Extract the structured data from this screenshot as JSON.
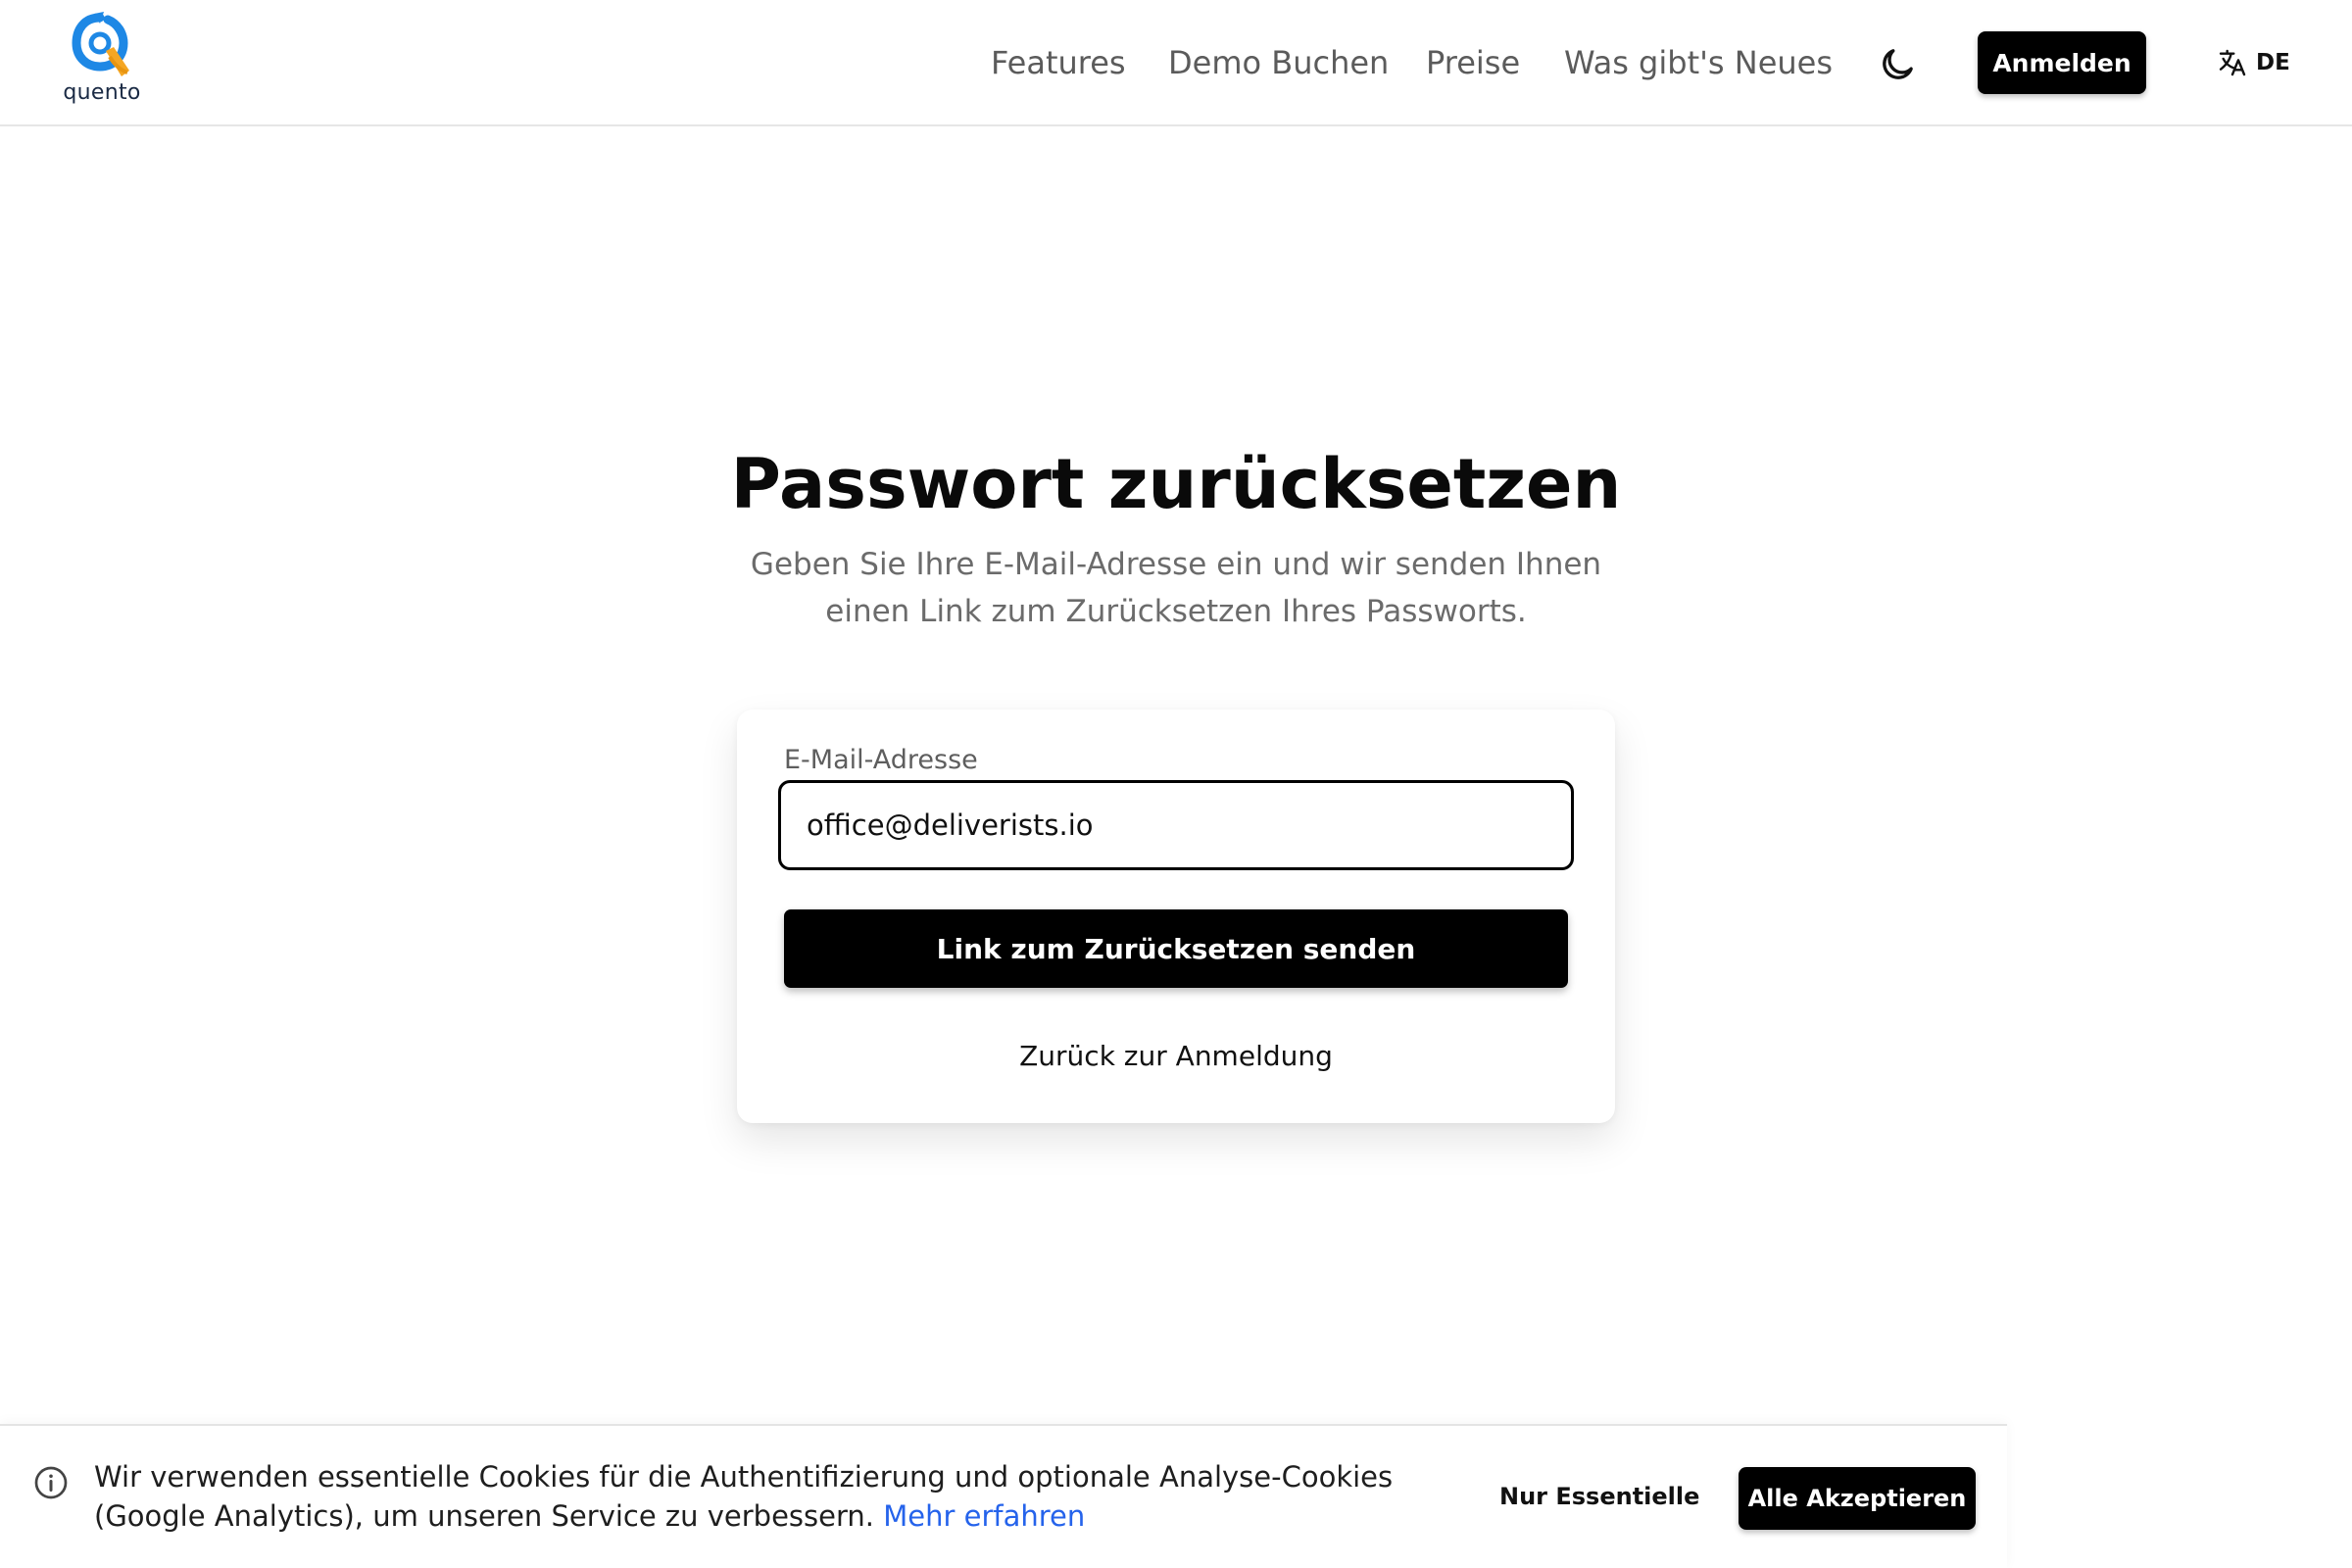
{
  "header": {
    "logo_text": "quento",
    "nav": {
      "features": "Features",
      "demo": "Demo Buchen",
      "preise": "Preise",
      "news": "Was gibt's Neues"
    },
    "theme_icon": "moon-icon",
    "login_label": "Anmelden",
    "language_icon": "translate-icon",
    "language_label": "DE"
  },
  "main": {
    "title": "Passwort zurücksetzen",
    "subtitle": "Geben Sie Ihre E-Mail-Adresse ein und wir senden Ihnen einen Link zum Zurücksetzen Ihres Passworts.",
    "form": {
      "email_label": "E-Mail-Adresse",
      "email_value": "office@deliverists.io",
      "submit_label": "Link zum Zurücksetzen senden",
      "back_label": "Zurück zur Anmeldung"
    }
  },
  "cookie_banner": {
    "info_icon": "info-icon",
    "text": "Wir verwenden essentielle Cookies für die Authentifizierung und optionale Analyse-Cookies (Google Analytics), um unseren Service zu verbessern.",
    "link_label": "Mehr erfahren",
    "essential_label": "Nur Essentielle",
    "accept_label": "Alle Akzeptieren"
  },
  "colors": {
    "primary": "#000000",
    "link": "#2563eb",
    "logo_blue": "#1e88e5",
    "logo_orange": "#f5a623"
  }
}
